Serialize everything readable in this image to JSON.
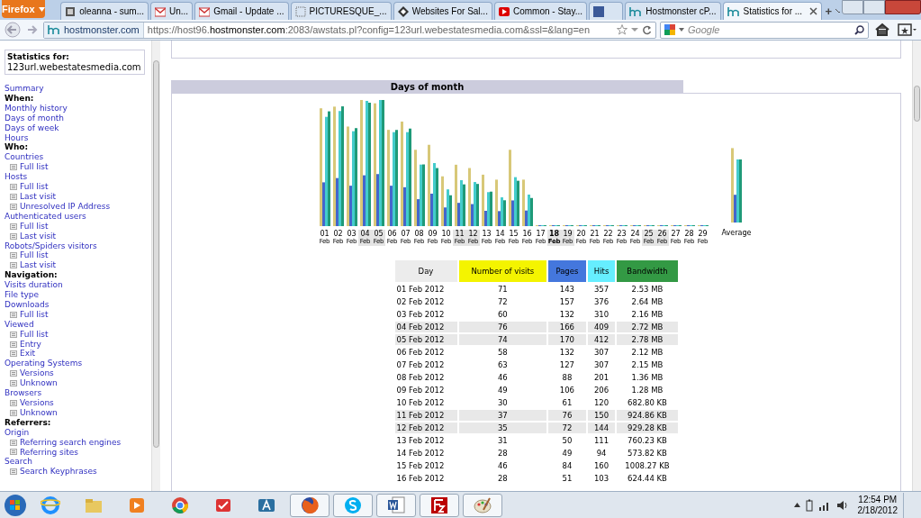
{
  "browser": {
    "menu_button": "Firefox",
    "tabs": [
      {
        "title": "oleanna - sum...",
        "kind": "page",
        "selected": false
      },
      {
        "title": "Un...",
        "kind": "mail",
        "selected": false
      },
      {
        "title": "Gmail - Update ...",
        "kind": "mail",
        "selected": false
      },
      {
        "title": "PICTURESQUE_...",
        "kind": "dotted",
        "selected": false
      },
      {
        "title": "Websites For Sal...",
        "kind": "diamond",
        "selected": false
      },
      {
        "title": "Common - Stay...",
        "kind": "video",
        "selected": false
      },
      {
        "kind": "social",
        "selected": false
      },
      {
        "title": "Hostmonster cP...",
        "kind": "hm",
        "selected": false
      },
      {
        "title": "Statistics for ...",
        "kind": "hm",
        "selected": true
      }
    ],
    "new_tab": "+",
    "identity": "hostmonster.com",
    "url": "https://host96.**hostmonster.com**:2083/awstats.pl?config=123url.webestatesmedia.com&ssl=&lang=en",
    "search_placeholder": "Google"
  },
  "sidebar": {
    "title": "Statistics for:",
    "site": "123url.webestatesmedia.com",
    "items": [
      {
        "kind": "link",
        "text": "Summary"
      },
      {
        "kind": "heading",
        "text": "When:"
      },
      {
        "kind": "link",
        "text": "Monthly history"
      },
      {
        "kind": "link",
        "text": "Days of month"
      },
      {
        "kind": "link",
        "text": "Days of week"
      },
      {
        "kind": "link",
        "text": "Hours"
      },
      {
        "kind": "heading",
        "text": "Who:"
      },
      {
        "kind": "link",
        "text": "Countries"
      },
      {
        "kind": "sub",
        "text": "Full list"
      },
      {
        "kind": "link",
        "text": "Hosts"
      },
      {
        "kind": "sub",
        "text": "Full list"
      },
      {
        "kind": "sub",
        "text": "Last visit"
      },
      {
        "kind": "sub",
        "text": "Unresolved IP Address"
      },
      {
        "kind": "link",
        "text": "Authenticated users"
      },
      {
        "kind": "sub",
        "text": "Full list"
      },
      {
        "kind": "sub",
        "text": "Last visit"
      },
      {
        "kind": "link",
        "text": "Robots/Spiders visitors"
      },
      {
        "kind": "sub",
        "text": "Full list"
      },
      {
        "kind": "sub",
        "text": "Last visit"
      },
      {
        "kind": "heading",
        "text": "Navigation:"
      },
      {
        "kind": "link",
        "text": "Visits duration"
      },
      {
        "kind": "link",
        "text": "File type"
      },
      {
        "kind": "link",
        "text": "Downloads"
      },
      {
        "kind": "sub",
        "text": "Full list"
      },
      {
        "kind": "link",
        "text": "Viewed"
      },
      {
        "kind": "sub",
        "text": "Full list"
      },
      {
        "kind": "sub",
        "text": "Entry"
      },
      {
        "kind": "sub",
        "text": "Exit"
      },
      {
        "kind": "link",
        "text": "Operating Systems"
      },
      {
        "kind": "sub",
        "text": "Versions"
      },
      {
        "kind": "sub",
        "text": "Unknown"
      },
      {
        "kind": "link",
        "text": "Browsers"
      },
      {
        "kind": "sub",
        "text": "Versions"
      },
      {
        "kind": "sub",
        "text": "Unknown"
      },
      {
        "kind": "heading",
        "text": "Referrers:"
      },
      {
        "kind": "link",
        "text": "Origin"
      },
      {
        "kind": "sub",
        "text": "Referring search engines"
      },
      {
        "kind": "sub",
        "text": "Referring sites"
      },
      {
        "kind": "link",
        "text": "Search"
      },
      {
        "kind": "sub",
        "text": "Search Keyphrases"
      }
    ]
  },
  "section": {
    "title": "Days of month",
    "days": [
      {
        "day": "01",
        "month": "Feb",
        "weekend": false,
        "today": false
      },
      {
        "day": "02",
        "month": "Feb",
        "weekend": false,
        "today": false
      },
      {
        "day": "03",
        "month": "Feb",
        "weekend": false,
        "today": false
      },
      {
        "day": "04",
        "month": "Feb",
        "weekend": true,
        "today": false
      },
      {
        "day": "05",
        "month": "Feb",
        "weekend": true,
        "today": false
      },
      {
        "day": "06",
        "month": "Feb",
        "weekend": false,
        "today": false
      },
      {
        "day": "07",
        "month": "Feb",
        "weekend": false,
        "today": false
      },
      {
        "day": "08",
        "month": "Feb",
        "weekend": false,
        "today": false
      },
      {
        "day": "09",
        "month": "Feb",
        "weekend": false,
        "today": false
      },
      {
        "day": "10",
        "month": "Feb",
        "weekend": false,
        "today": false
      },
      {
        "day": "11",
        "month": "Feb",
        "weekend": true,
        "today": false
      },
      {
        "day": "12",
        "month": "Feb",
        "weekend": true,
        "today": false
      },
      {
        "day": "13",
        "month": "Feb",
        "weekend": false,
        "today": false
      },
      {
        "day": "14",
        "month": "Feb",
        "weekend": false,
        "today": false
      },
      {
        "day": "15",
        "month": "Feb",
        "weekend": false,
        "today": false
      },
      {
        "day": "16",
        "month": "Feb",
        "weekend": false,
        "today": false
      },
      {
        "day": "17",
        "month": "Feb",
        "weekend": false,
        "today": false
      },
      {
        "day": "18",
        "month": "Feb",
        "weekend": true,
        "today": true
      },
      {
        "day": "19",
        "month": "Feb",
        "weekend": true,
        "today": false
      },
      {
        "day": "20",
        "month": "Feb",
        "weekend": false,
        "today": false
      },
      {
        "day": "21",
        "month": "Feb",
        "weekend": false,
        "today": false
      },
      {
        "day": "22",
        "month": "Feb",
        "weekend": false,
        "today": false
      },
      {
        "day": "23",
        "month": "Feb",
        "weekend": false,
        "today": false
      },
      {
        "day": "24",
        "month": "Feb",
        "weekend": false,
        "today": false
      },
      {
        "day": "25",
        "month": "Feb",
        "weekend": true,
        "today": false
      },
      {
        "day": "26",
        "month": "Feb",
        "weekend": true,
        "today": false
      },
      {
        "day": "27",
        "month": "Feb",
        "weekend": false,
        "today": false
      },
      {
        "day": "28",
        "month": "Feb",
        "weekend": false,
        "today": false
      },
      {
        "day": "29",
        "month": "Feb",
        "weekend": false,
        "today": false
      }
    ],
    "average_label": "Average",
    "table": {
      "columns": [
        {
          "label": "Day",
          "color": "#ececec"
        },
        {
          "label": "Number of visits",
          "color": "#f4f400"
        },
        {
          "label": "Pages",
          "color": "#4477dd"
        },
        {
          "label": "Hits",
          "color": "#66eeff"
        },
        {
          "label": "Bandwidth",
          "color": "#339944"
        }
      ],
      "rows": [
        {
          "cells": [
            "01 Feb 2012",
            "71",
            "143",
            "357",
            "2.53 MB"
          ],
          "weekend": false
        },
        {
          "cells": [
            "02 Feb 2012",
            "72",
            "157",
            "376",
            "2.64 MB"
          ],
          "weekend": false
        },
        {
          "cells": [
            "03 Feb 2012",
            "60",
            "132",
            "310",
            "2.16 MB"
          ],
          "weekend": false
        },
        {
          "cells": [
            "04 Feb 2012",
            "76",
            "166",
            "409",
            "2.72 MB"
          ],
          "weekend": true
        },
        {
          "cells": [
            "05 Feb 2012",
            "74",
            "170",
            "412",
            "2.78 MB"
          ],
          "weekend": true
        },
        {
          "cells": [
            "06 Feb 2012",
            "58",
            "132",
            "307",
            "2.12 MB"
          ],
          "weekend": false
        },
        {
          "cells": [
            "07 Feb 2012",
            "63",
            "127",
            "307",
            "2.15 MB"
          ],
          "weekend": false
        },
        {
          "cells": [
            "08 Feb 2012",
            "46",
            "88",
            "201",
            "1.36 MB"
          ],
          "weekend": false
        },
        {
          "cells": [
            "09 Feb 2012",
            "49",
            "106",
            "206",
            "1.28 MB"
          ],
          "weekend": false
        },
        {
          "cells": [
            "10 Feb 2012",
            "30",
            "61",
            "120",
            "682.80 KB"
          ],
          "weekend": false
        },
        {
          "cells": [
            "11 Feb 2012",
            "37",
            "76",
            "150",
            "924.86 KB"
          ],
          "weekend": true
        },
        {
          "cells": [
            "12 Feb 2012",
            "35",
            "72",
            "144",
            "929.28 KB"
          ],
          "weekend": true
        },
        {
          "cells": [
            "13 Feb 2012",
            "31",
            "50",
            "111",
            "760.23 KB"
          ],
          "weekend": false
        },
        {
          "cells": [
            "14 Feb 2012",
            "28",
            "49",
            "94",
            "573.82 KB"
          ],
          "weekend": false
        },
        {
          "cells": [
            "15 Feb 2012",
            "46",
            "84",
            "160",
            "1008.27 KB"
          ],
          "weekend": false
        },
        {
          "cells": [
            "16 Feb 2012",
            "28",
            "51",
            "103",
            "624.44 KB"
          ],
          "weekend": false
        }
      ]
    }
  },
  "taskbar": {
    "apps": [
      {
        "kind": "ie",
        "running": false
      },
      {
        "kind": "folder",
        "running": false
      },
      {
        "kind": "media",
        "running": false
      },
      {
        "kind": "chrome",
        "running": false
      },
      {
        "kind": "todo",
        "running": false
      },
      {
        "kind": "letter",
        "running": false
      },
      {
        "kind": "firefox",
        "running": true
      },
      {
        "kind": "skype",
        "running": true
      },
      {
        "kind": "word",
        "running": true
      },
      {
        "kind": "ftp",
        "running": true
      },
      {
        "kind": "paint",
        "running": true
      }
    ],
    "time": "12:54 PM",
    "date": "2/18/2012"
  }
}
